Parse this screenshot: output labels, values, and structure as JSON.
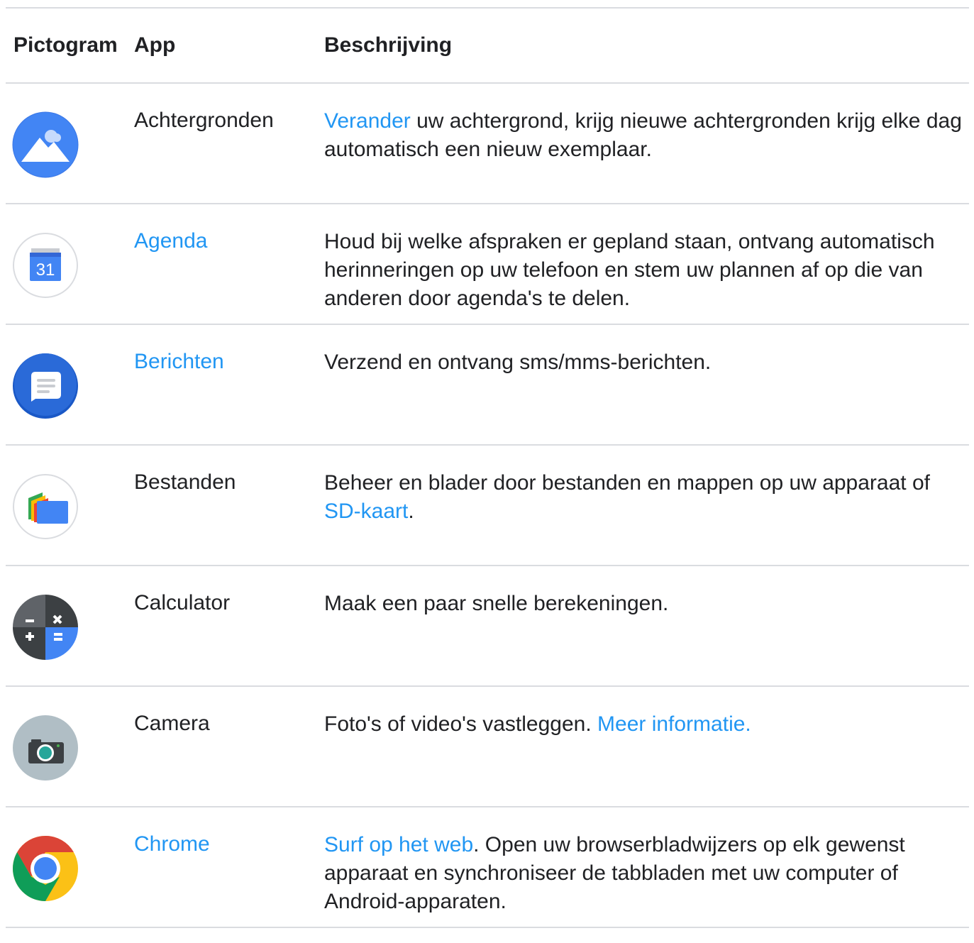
{
  "table": {
    "headers": {
      "icon": "Pictogram",
      "app": "App",
      "description": "Beschrijving"
    },
    "rows": [
      {
        "icon": "wallpapers-icon",
        "app": "Achtergronden",
        "app_is_link": false,
        "desc_link": "Verander",
        "desc_text": " uw achtergrond, krijg nieuwe achtergronden krijg elke dag automatisch een nieuw exemplaar."
      },
      {
        "icon": "calendar-icon",
        "calendar_day": "31",
        "app": "Agenda",
        "app_is_link": true,
        "desc_text": "Houd bij welke afspraken er gepland staan, ontvang automatisch herinneringen op uw telefoon en stem uw plannen af op die van anderen door agenda's te delen."
      },
      {
        "icon": "messages-icon",
        "app": "Berichten",
        "app_is_link": true,
        "desc_text": "Verzend en ontvang sms/mms-berichten."
      },
      {
        "icon": "files-icon",
        "app": "Bestanden",
        "app_is_link": false,
        "desc_text_before": "Beheer en blader door bestanden en mappen op uw apparaat of ",
        "desc_link": "SD-kaart",
        "desc_text_after": "."
      },
      {
        "icon": "calculator-icon",
        "app": "Calculator",
        "app_is_link": false,
        "desc_text": "Maak een paar snelle berekeningen."
      },
      {
        "icon": "camera-icon",
        "app": "Camera",
        "app_is_link": false,
        "desc_text": "Foto's of video's vastleggen. ",
        "desc_link": "Meer informatie."
      },
      {
        "icon": "chrome-icon",
        "app": "Chrome",
        "app_is_link": true,
        "desc_link": "Surf op het web",
        "desc_text": ". Open uw browserbladwijzers op elk gewenst apparaat en synchroniseer de tabbladen met uw computer of Android-apparaten."
      }
    ]
  },
  "colors": {
    "link": "#2196f3",
    "text": "#202124",
    "rule": "#dadce0"
  }
}
